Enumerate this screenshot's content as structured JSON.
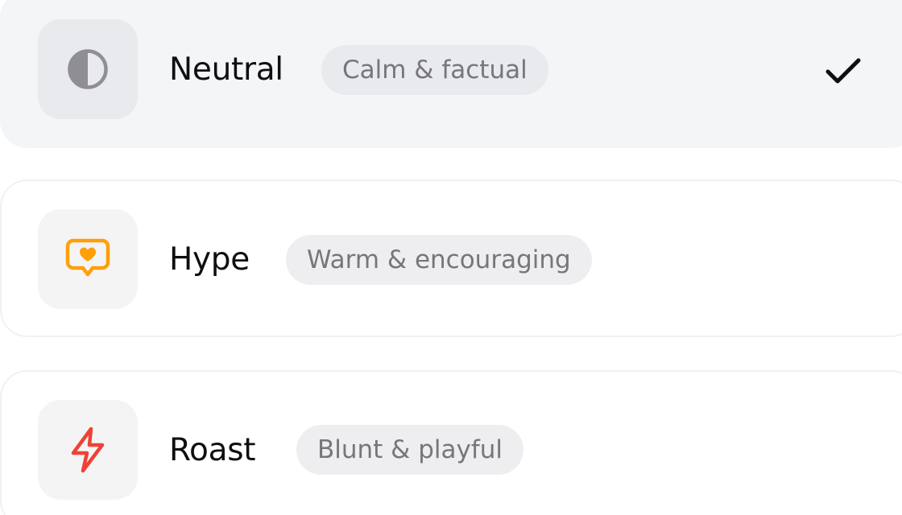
{
  "options": [
    {
      "title": "Neutral",
      "subtitle": "Calm & factual",
      "icon": "half-circle-icon",
      "icon_color": "#8e8e93",
      "selected": true
    },
    {
      "title": "Hype",
      "subtitle": "Warm & encouraging",
      "icon": "heart-chat-icon",
      "icon_color": "#ff9f0a",
      "selected": false
    },
    {
      "title": "Roast",
      "subtitle": "Blunt & playful",
      "icon": "lightning-bolt-icon",
      "icon_color": "#ef4136",
      "selected": false
    }
  ],
  "colors": {
    "selected_background": "#f4f5f7",
    "title": "#0f0f12",
    "subtitle": "#76767b",
    "check": "#0f0f12"
  }
}
